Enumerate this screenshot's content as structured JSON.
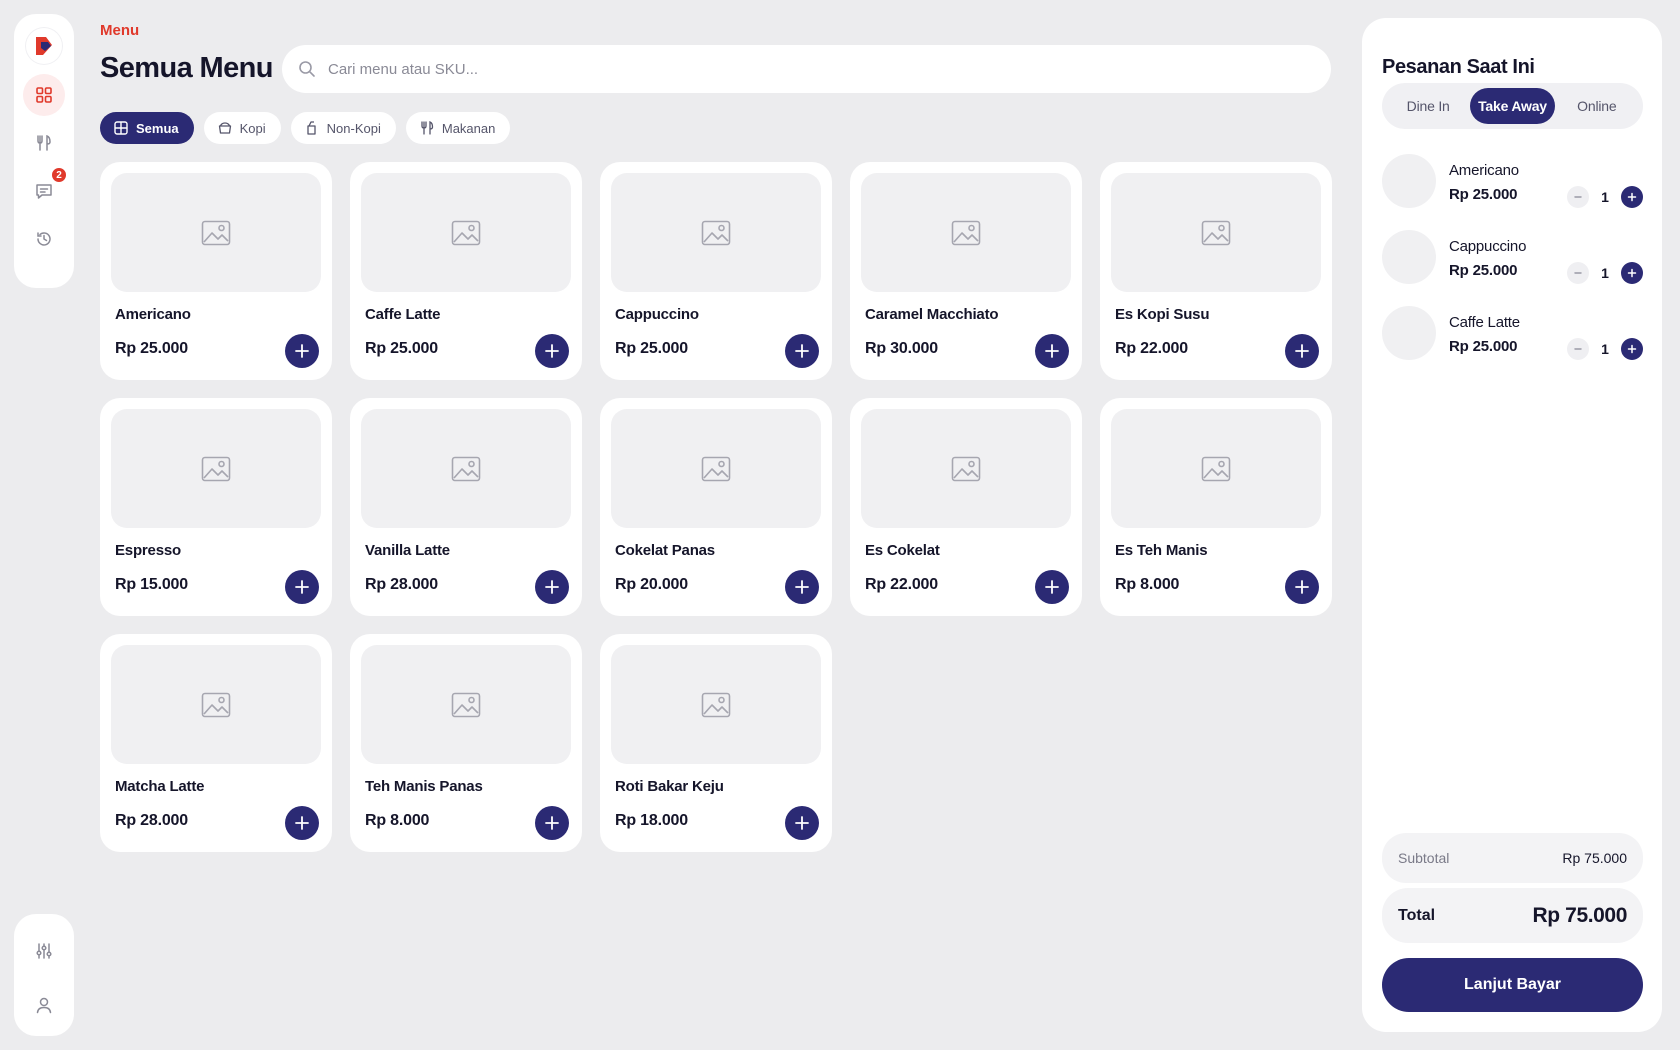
{
  "nav": {
    "items": [
      {
        "icon": "grid-icon",
        "active": true
      },
      {
        "icon": "utensils-icon"
      },
      {
        "icon": "chat-icon",
        "badge": "2"
      },
      {
        "icon": "history-icon"
      }
    ],
    "bottom": [
      {
        "icon": "sliders-icon"
      },
      {
        "icon": "user-icon"
      }
    ]
  },
  "header": {
    "crumb": "Menu",
    "title": "Semua Menu"
  },
  "search": {
    "placeholder": "Cari menu atau SKU..."
  },
  "categories": [
    {
      "label": "Semua",
      "icon": "grid-icon",
      "active": true
    },
    {
      "label": "Kopi",
      "icon": "coffee-cup-icon"
    },
    {
      "label": "Non-Kopi",
      "icon": "cup-icon"
    },
    {
      "label": "Makanan",
      "icon": "utensils-icon"
    }
  ],
  "products": [
    {
      "name": "Americano",
      "price": "Rp 25.000"
    },
    {
      "name": "Caffe Latte",
      "price": "Rp 25.000"
    },
    {
      "name": "Cappuccino",
      "price": "Rp 25.000"
    },
    {
      "name": "Caramel Macchiato",
      "price": "Rp 30.000"
    },
    {
      "name": "Es Kopi Susu",
      "price": "Rp 22.000"
    },
    {
      "name": "Espresso",
      "price": "Rp 15.000"
    },
    {
      "name": "Vanilla Latte",
      "price": "Rp 28.000"
    },
    {
      "name": "Cokelat Panas",
      "price": "Rp 20.000"
    },
    {
      "name": "Es Cokelat",
      "price": "Rp 22.000"
    },
    {
      "name": "Es Teh Manis",
      "price": "Rp 8.000"
    },
    {
      "name": "Matcha Latte",
      "price": "Rp 28.000"
    },
    {
      "name": "Teh Manis Panas",
      "price": "Rp 8.000"
    },
    {
      "name": "Roti Bakar Keju",
      "price": "Rp 18.000"
    }
  ],
  "order": {
    "title": "Pesanan Saat Ini",
    "modes": [
      "Dine In",
      "Take Away",
      "Online"
    ],
    "active_mode": "Take Away",
    "items": [
      {
        "name": "Americano",
        "price": "Rp 25.000",
        "qty": "1"
      },
      {
        "name": "Cappuccino",
        "price": "Rp 25.000",
        "qty": "1"
      },
      {
        "name": "Caffe Latte",
        "price": "Rp 25.000",
        "qty": "1"
      }
    ],
    "subtotal_label": "Subtotal",
    "subtotal": "Rp 75.000",
    "total_label": "Total",
    "total": "Rp 75.000",
    "pay_label": "Lanjut Bayar"
  },
  "colors": {
    "accent": "#2b2a74",
    "brand_red": "#e0392b",
    "background": "#ececee"
  }
}
